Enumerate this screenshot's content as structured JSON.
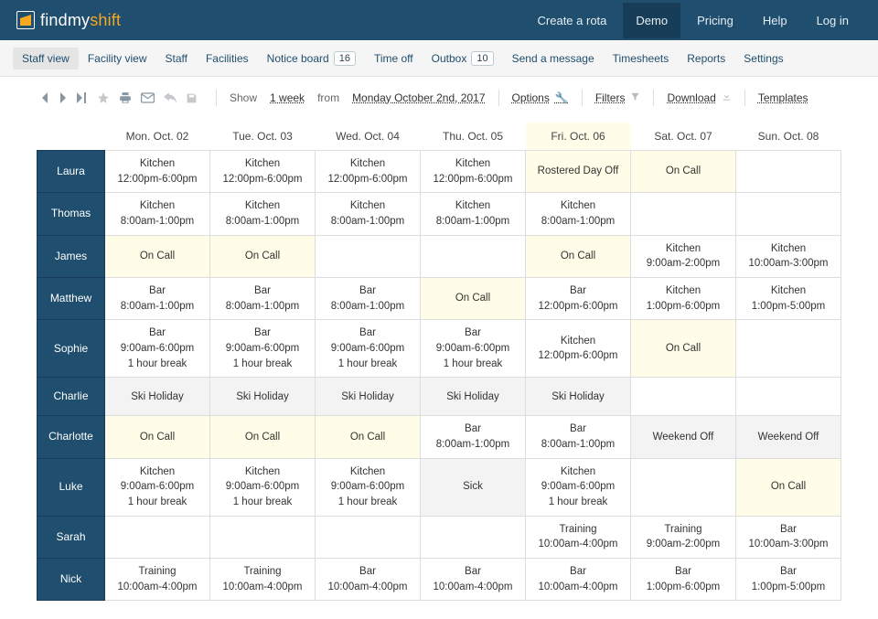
{
  "brand": {
    "pre": "findmy",
    "em": "shift"
  },
  "topnav": {
    "create": "Create a rota",
    "demo": "Demo",
    "pricing": "Pricing",
    "help": "Help",
    "login": "Log in"
  },
  "subnav": {
    "staff_view": "Staff view",
    "facility_view": "Facility view",
    "staff": "Staff",
    "facilities": "Facilities",
    "notice_board": "Notice board",
    "notice_badge": "16",
    "time_off": "Time off",
    "outbox": "Outbox",
    "outbox_badge": "10",
    "send_message": "Send a message",
    "timesheets": "Timesheets",
    "reports": "Reports",
    "settings": "Settings"
  },
  "toolbar": {
    "show_label": "Show",
    "range": "1 week",
    "from_label": "from",
    "date": "Monday October 2nd, 2017",
    "options": "Options",
    "filters": "Filters",
    "download": "Download",
    "templates": "Templates"
  },
  "days": [
    "Mon. Oct. 02",
    "Tue. Oct. 03",
    "Wed. Oct. 04",
    "Thu. Oct. 05",
    "Fri. Oct. 06",
    "Sat. Oct. 07",
    "Sun. Oct. 08"
  ],
  "highlight_col": 4,
  "staff": [
    {
      "name": "Laura",
      "cells": [
        {
          "l1": "Kitchen",
          "l2": "12:00pm-6:00pm"
        },
        {
          "l1": "Kitchen",
          "l2": "12:00pm-6:00pm"
        },
        {
          "l1": "Kitchen",
          "l2": "12:00pm-6:00pm"
        },
        {
          "l1": "Kitchen",
          "l2": "12:00pm-6:00pm"
        },
        {
          "l1": "Rostered Day Off",
          "cls": "yellow"
        },
        {
          "l1": "On Call",
          "cls": "yellow"
        },
        {
          "l1": ""
        }
      ]
    },
    {
      "name": "Thomas",
      "cells": [
        {
          "l1": "Kitchen",
          "l2": "8:00am-1:00pm"
        },
        {
          "l1": "Kitchen",
          "l2": "8:00am-1:00pm"
        },
        {
          "l1": "Kitchen",
          "l2": "8:00am-1:00pm"
        },
        {
          "l1": "Kitchen",
          "l2": "8:00am-1:00pm"
        },
        {
          "l1": "Kitchen",
          "l2": "8:00am-1:00pm"
        },
        {
          "l1": ""
        },
        {
          "l1": ""
        }
      ]
    },
    {
      "name": "James",
      "cells": [
        {
          "l1": "On Call",
          "cls": "yellow"
        },
        {
          "l1": "On Call",
          "cls": "yellow"
        },
        {
          "l1": ""
        },
        {
          "l1": ""
        },
        {
          "l1": "On Call",
          "cls": "yellow"
        },
        {
          "l1": "Kitchen",
          "l2": "9:00am-2:00pm"
        },
        {
          "l1": "Kitchen",
          "l2": "10:00am-3:00pm"
        }
      ]
    },
    {
      "name": "Matthew",
      "cells": [
        {
          "l1": "Bar",
          "l2": "8:00am-1:00pm"
        },
        {
          "l1": "Bar",
          "l2": "8:00am-1:00pm"
        },
        {
          "l1": "Bar",
          "l2": "8:00am-1:00pm"
        },
        {
          "l1": "On Call",
          "cls": "yellow"
        },
        {
          "l1": "Bar",
          "l2": "12:00pm-6:00pm"
        },
        {
          "l1": "Kitchen",
          "l2": "1:00pm-6:00pm"
        },
        {
          "l1": "Kitchen",
          "l2": "1:00pm-5:00pm"
        }
      ]
    },
    {
      "name": "Sophie",
      "cells": [
        {
          "l1": "Bar",
          "l2": "9:00am-6:00pm",
          "l3": "1 hour break"
        },
        {
          "l1": "Bar",
          "l2": "9:00am-6:00pm",
          "l3": "1 hour break"
        },
        {
          "l1": "Bar",
          "l2": "9:00am-6:00pm",
          "l3": "1 hour break"
        },
        {
          "l1": "Bar",
          "l2": "9:00am-6:00pm",
          "l3": "1 hour break"
        },
        {
          "l1": "Kitchen",
          "l2": "12:00pm-6:00pm"
        },
        {
          "l1": "On Call",
          "cls": "yellow"
        },
        {
          "l1": ""
        }
      ]
    },
    {
      "name": "Charlie",
      "cells": [
        {
          "l1": "Ski Holiday",
          "cls": "gray"
        },
        {
          "l1": "Ski Holiday",
          "cls": "gray"
        },
        {
          "l1": "Ski Holiday",
          "cls": "gray"
        },
        {
          "l1": "Ski Holiday",
          "cls": "gray"
        },
        {
          "l1": "Ski Holiday",
          "cls": "gray"
        },
        {
          "l1": ""
        },
        {
          "l1": ""
        }
      ]
    },
    {
      "name": "Charlotte",
      "cells": [
        {
          "l1": "On Call",
          "cls": "yellow"
        },
        {
          "l1": "On Call",
          "cls": "yellow"
        },
        {
          "l1": "On Call",
          "cls": "yellow"
        },
        {
          "l1": "Bar",
          "l2": "8:00am-1:00pm"
        },
        {
          "l1": "Bar",
          "l2": "8:00am-1:00pm"
        },
        {
          "l1": "Weekend Off",
          "cls": "gray"
        },
        {
          "l1": "Weekend Off",
          "cls": "gray"
        }
      ]
    },
    {
      "name": "Luke",
      "cells": [
        {
          "l1": "Kitchen",
          "l2": "9:00am-6:00pm",
          "l3": "1 hour break"
        },
        {
          "l1": "Kitchen",
          "l2": "9:00am-6:00pm",
          "l3": "1 hour break"
        },
        {
          "l1": "Kitchen",
          "l2": "9:00am-6:00pm",
          "l3": "1 hour break"
        },
        {
          "l1": "Sick",
          "cls": "gray"
        },
        {
          "l1": "Kitchen",
          "l2": "9:00am-6:00pm",
          "l3": "1 hour break"
        },
        {
          "l1": ""
        },
        {
          "l1": "On Call",
          "cls": "yellow"
        }
      ]
    },
    {
      "name": "Sarah",
      "cells": [
        {
          "l1": ""
        },
        {
          "l1": ""
        },
        {
          "l1": ""
        },
        {
          "l1": ""
        },
        {
          "l1": "Training",
          "l2": "10:00am-4:00pm"
        },
        {
          "l1": "Training",
          "l2": "9:00am-2:00pm"
        },
        {
          "l1": "Bar",
          "l2": "10:00am-3:00pm"
        }
      ]
    },
    {
      "name": "Nick",
      "cells": [
        {
          "l1": "Training",
          "l2": "10:00am-4:00pm"
        },
        {
          "l1": "Training",
          "l2": "10:00am-4:00pm"
        },
        {
          "l1": "Bar",
          "l2": "10:00am-4:00pm"
        },
        {
          "l1": "Bar",
          "l2": "10:00am-4:00pm"
        },
        {
          "l1": "Bar",
          "l2": "10:00am-4:00pm"
        },
        {
          "l1": "Bar",
          "l2": "1:00pm-6:00pm"
        },
        {
          "l1": "Bar",
          "l2": "1:00pm-5:00pm"
        }
      ]
    }
  ]
}
